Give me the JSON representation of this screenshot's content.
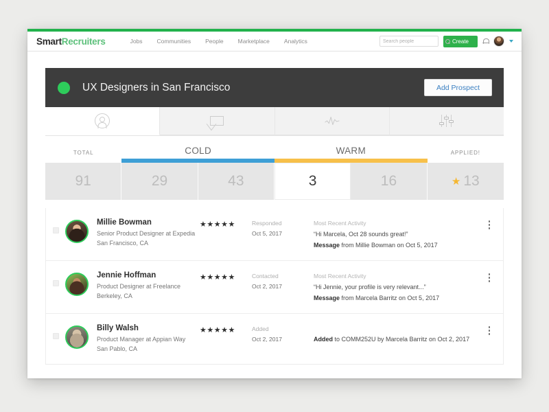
{
  "topnav": {
    "brand_first": "Smart",
    "brand_second": "Recruiters",
    "links": [
      {
        "label": "Jobs"
      },
      {
        "label": "Communities"
      },
      {
        "label": "People"
      },
      {
        "label": "Marketplace"
      },
      {
        "label": "Analytics"
      }
    ],
    "search_placeholder": "Search people",
    "search_value": "",
    "create_label": "Create",
    "icons": {
      "search": "search-icon",
      "bell": "bell-icon",
      "avatar": "user-avatar",
      "caret": "chevron-down-icon"
    }
  },
  "header": {
    "status_dot_color": "#2ecc5b",
    "title": "UX Designers in San Francisco",
    "add_prospect_label": "Add Prospect"
  },
  "tabs": [
    {
      "name": "tab-people",
      "icon": "person-icon",
      "active": true
    },
    {
      "name": "tab-messages",
      "icon": "envelope-icon",
      "active": false
    },
    {
      "name": "tab-activity",
      "icon": "activity-chart-icon",
      "active": false
    },
    {
      "name": "tab-settings",
      "icon": "sliders-icon",
      "active": false
    }
  ],
  "stats": {
    "labels": {
      "total": "TOTAL",
      "cold": "COLD",
      "warm": "WARM",
      "applied": "APPLIED!"
    },
    "bar_colors": {
      "cold": "#3e9fd6",
      "warm": "#f7c04a"
    },
    "cells": [
      {
        "name": "stat-total",
        "value": "91",
        "active": false,
        "star": false
      },
      {
        "name": "stat-cold-1",
        "value": "29",
        "active": false,
        "star": false
      },
      {
        "name": "stat-cold-2",
        "value": "43",
        "active": false,
        "star": false
      },
      {
        "name": "stat-warm-1",
        "value": "3",
        "active": true,
        "star": false
      },
      {
        "name": "stat-warm-2",
        "value": "16",
        "active": false,
        "star": false
      },
      {
        "name": "stat-applied",
        "value": "13",
        "active": false,
        "star": true
      }
    ],
    "star_glyph": "★"
  },
  "prospects": [
    {
      "name": "Millie Bowman",
      "title": "Senior Product Designer at Expedia",
      "location": "San Francisco, CA",
      "stars": "★★★★★",
      "status": "Responded",
      "date": "Oct 5, 2017",
      "activity_title": "Most Recent Activity",
      "quote": "“Hi Marcela, Oct 28 sounds great!”",
      "meta_bold": "Message",
      "meta_rest": " from Millie Bowman on Oct 5, 2017"
    },
    {
      "name": "Jennie Hoffman",
      "title": "Product Designer at Freelance",
      "location": "Berkeley, CA",
      "stars": "★★★★★",
      "status": "Contacted",
      "date": "Oct 2, 2017",
      "activity_title": "Most Recent Activity",
      "quote": "“Hi Jennie, your profile is very relevant...”",
      "meta_bold": "Message",
      "meta_rest": " from Marcela Barritz on Oct 5, 2017"
    },
    {
      "name": "Billy Walsh",
      "title": "Product Manager at Appian Way",
      "location": "San Pablo, CA",
      "stars": "★★★★★",
      "status": "Added",
      "date": "Oct 2, 2017",
      "activity_title": "",
      "quote": "",
      "meta_bold": "Added",
      "meta_rest": " to COMM252U by Marcela Barritz on Oct 2, 2017"
    }
  ]
}
